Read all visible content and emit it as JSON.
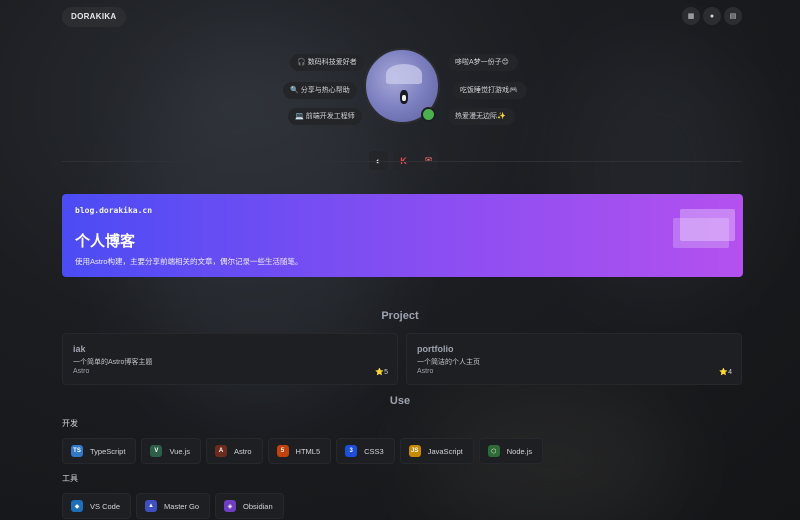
{
  "header": {
    "brand": "DORAKIKA",
    "icons": [
      "grid-icon",
      "sun-icon",
      "archive-icon"
    ]
  },
  "profile": {
    "tags_left": [
      {
        "icon": "🎧",
        "text": "数码科技爱好者"
      },
      {
        "icon": "🔍",
        "text": "分享与热心帮助"
      },
      {
        "icon": "💻",
        "text": "前端开发工程师"
      }
    ],
    "tags_right": [
      {
        "text": "哆啦A梦一份子",
        "icon": "😊"
      },
      {
        "text": "吃饭睡觉打游戏",
        "icon": "🎮"
      },
      {
        "text": "热爱漫无边际",
        "icon": "✨"
      }
    ],
    "status_color": "#4caf50"
  },
  "socials": [
    {
      "name": "github-icon",
      "glyph": "◐",
      "color": "#111111"
    },
    {
      "name": "kotlin-icon",
      "glyph": "K",
      "color": "#e44857"
    },
    {
      "name": "mail-icon",
      "glyph": "✉",
      "color": "#f87171"
    }
  ],
  "blog": {
    "url": "blog.dorakika.cn",
    "title": "个人博客",
    "description": "使用Astro构建，主要分享前端相关的文章，偶尔记录一些生活随笔。",
    "gradient": [
      "#4b4cf4",
      "#b451ef"
    ]
  },
  "projects_section": {
    "title": "Project",
    "items": [
      {
        "name": "iak",
        "desc": "一个简单的Astro博客主题",
        "lang": "Astro",
        "stars": "⭐5"
      },
      {
        "name": "portfolio",
        "desc": "一个简洁的个人主页",
        "lang": "Astro",
        "stars": "⭐4"
      }
    ]
  },
  "use_section": {
    "title": "Use",
    "groups": [
      {
        "label": "开发",
        "items": [
          {
            "name": "TypeScript",
            "icon": "typescript-icon",
            "glyph": "TS",
            "color": "#3178c6"
          },
          {
            "name": "Vue.js",
            "icon": "vue-icon",
            "glyph": "V",
            "color": "#2c5f48"
          },
          {
            "name": "Astro",
            "icon": "astro-icon",
            "glyph": "A",
            "color": "#6b2b1d"
          },
          {
            "name": "HTML5",
            "icon": "html5-icon",
            "glyph": "5",
            "color": "#c2410c"
          },
          {
            "name": "CSS3",
            "icon": "css3-icon",
            "glyph": "3",
            "color": "#1d4ed8"
          },
          {
            "name": "JavaScript",
            "icon": "javascript-icon",
            "glyph": "JS",
            "color": "#ca8a04"
          },
          {
            "name": "Node.js",
            "icon": "nodejs-icon",
            "glyph": "⬡",
            "color": "#2f6b36"
          }
        ]
      },
      {
        "label": "工具",
        "items": [
          {
            "name": "VS Code",
            "icon": "vscode-icon",
            "glyph": "◆",
            "color": "#1e6fb8"
          },
          {
            "name": "Master Go",
            "icon": "mastergo-icon",
            "glyph": "▲",
            "color": "#3f4fbf"
          },
          {
            "name": "Obsidian",
            "icon": "obsidian-icon",
            "glyph": "◈",
            "color": "#6d3fc0"
          }
        ]
      }
    ]
  }
}
